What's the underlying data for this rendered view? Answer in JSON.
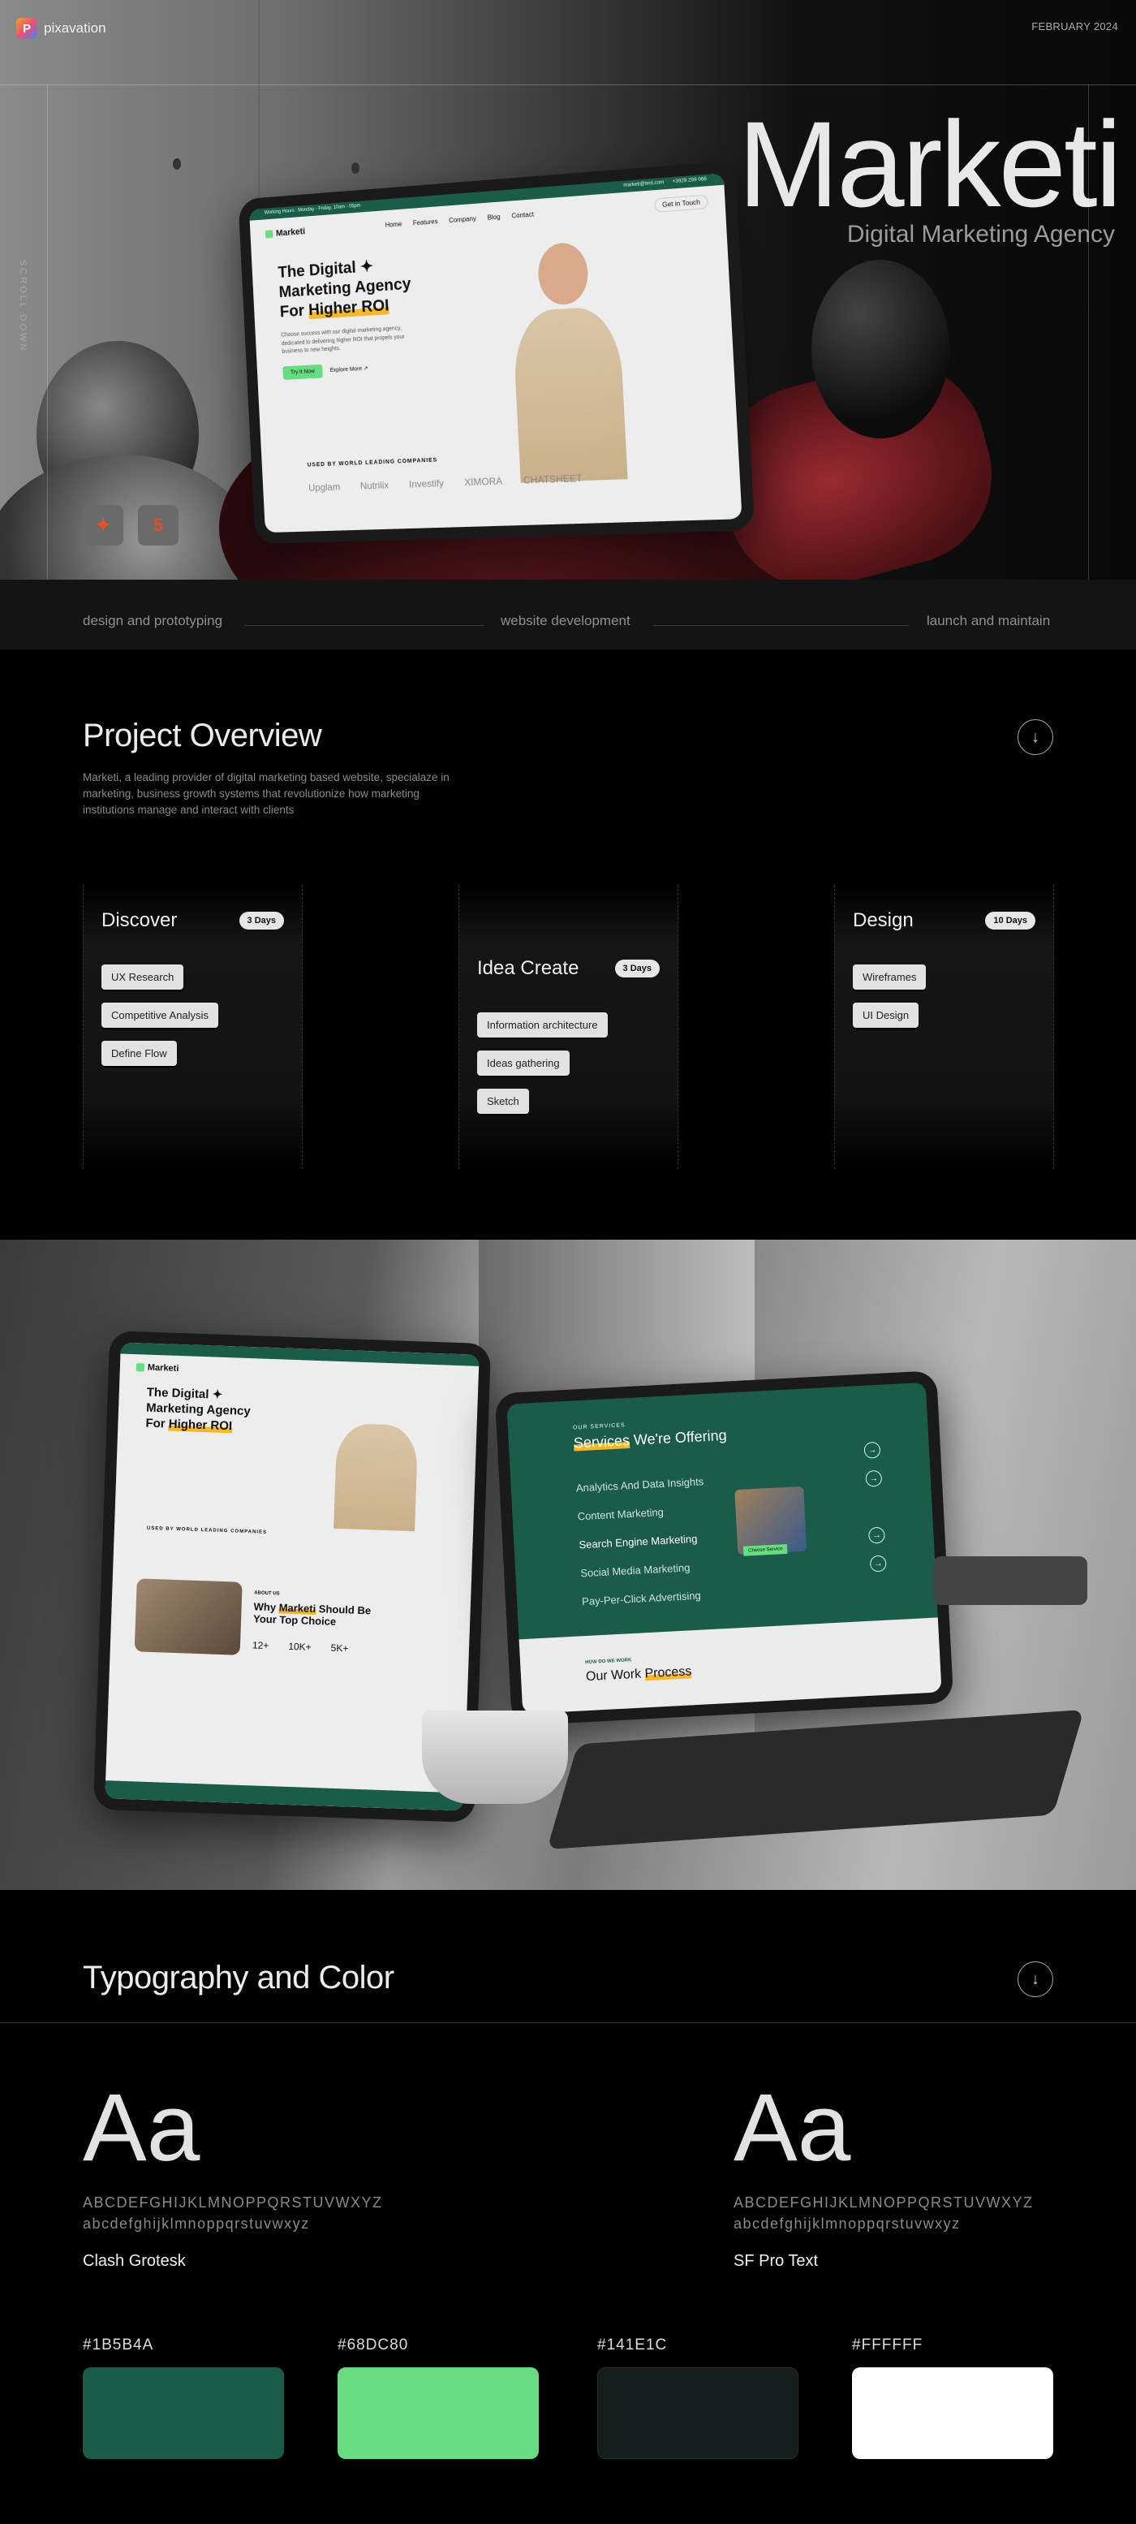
{
  "header": {
    "logo_text": "pixavation",
    "logo_letter": "P",
    "date": "FEBRUARY 2024"
  },
  "hero": {
    "title": "Marketi",
    "subtitle": "Digital Marketing Agency",
    "scroll_label": "SCROLL DOWN",
    "tools": [
      {
        "icon": "figma-icon",
        "glyph": "✦"
      },
      {
        "icon": "html5-icon",
        "glyph": "5"
      }
    ]
  },
  "mockup_site": {
    "topbar": "Working Hours : Monday - Friday, 10am - 05pm",
    "email": "marketi@test.com",
    "phone": "+3929 299 066",
    "logo": "Marketi",
    "nav": [
      "Home",
      "Features",
      "Company",
      "Blog",
      "Contact"
    ],
    "cta": "Get in Touch",
    "headline_1": "The Digital ✦",
    "headline_2": "Marketing Agency",
    "headline_3a": "For ",
    "headline_3b": "Higher ROI",
    "paragraph": "Choose success with our digital marketing agency, dedicated to delivering higher ROI that propels your business to new heights.",
    "try_btn": "Try It Now",
    "explore_btn": "Explore More ↗",
    "used_by": "USED BY WORLD LEADING COMPANIES",
    "companies": [
      "Upglam",
      "Nutrilix",
      "Investify",
      "XIMORA",
      "CHATSHEET"
    ]
  },
  "mockup_services": {
    "eyebrow": "OUR SERVICES",
    "title_a": "Services",
    "title_b": " We're Offering",
    "items": [
      "Analytics And Data Insights",
      "Content Marketing",
      "Search Engine Marketing",
      "Social Media Marketing",
      "Pay-Per-Click Advertising"
    ],
    "choose": "Choose Service",
    "process_eyebrow": "HOW DO WE WORK",
    "process_title_a": "Our Work ",
    "process_title_b": "Process"
  },
  "mockup_about": {
    "eyebrow": "ABOUT US",
    "title_a": "Why ",
    "title_b": "Marketi",
    "title_c": " Should Be Your Top Choice",
    "stats": [
      "12+",
      "10K+",
      "5K+"
    ]
  },
  "phases_band": [
    "design and prototyping",
    "website development",
    "launch and maintain"
  ],
  "overview": {
    "title": "Project Overview",
    "description": "Marketi, a leading provider of digital marketing based website, specialaze in marketing, business growth systems that revolutionize how marketing institutions manage and interact with clients",
    "columns": [
      {
        "title": "Discover",
        "duration": "3 Days",
        "tasks": [
          "UX Research",
          "Competitive Analysis",
          "Define Flow"
        ]
      },
      {
        "title": "Idea Create",
        "duration": "3 Days",
        "tasks": [
          "Information architecture",
          "Ideas gathering",
          "Sketch"
        ]
      },
      {
        "title": "Design",
        "duration": "10 Days",
        "tasks": [
          "Wireframes",
          "UI Design"
        ]
      }
    ]
  },
  "typography": {
    "title": "Typography and Color",
    "fonts": [
      {
        "sample": "Aa",
        "upper": "ABCDEFGHIJKLMNOPPQRSTUVWXYZ",
        "lower": "abcdefghijklmnoppqrstuvwxyz",
        "name": "Clash Grotesk"
      },
      {
        "sample": "Aa",
        "upper": "ABCDEFGHIJKLMNOPPQRSTUVWXYZ",
        "lower": "abcdefghijklmnoppqrstuvwxyz",
        "name": "SF Pro Text"
      }
    ],
    "colors": [
      {
        "label": "#1B5B4A",
        "hex": "#1B5B4A"
      },
      {
        "label": "#68DC80",
        "hex": "#68DC80"
      },
      {
        "label": "#141E1C",
        "hex": "#141E1C"
      },
      {
        "label": "#FFFFFF",
        "hex": "#FFFFFF"
      }
    ]
  }
}
